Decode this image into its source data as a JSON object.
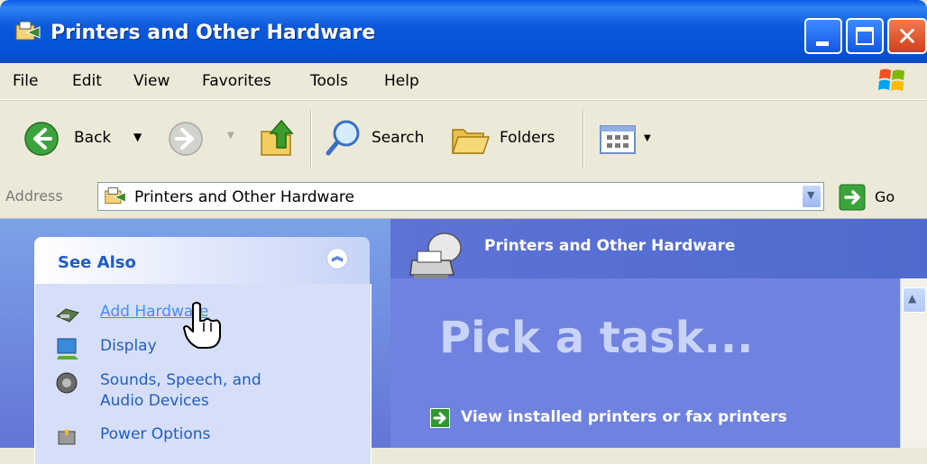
{
  "window": {
    "title": "Printers and Other Hardware"
  },
  "menu": {
    "items": [
      "File",
      "Edit",
      "View",
      "Favorites",
      "Tools",
      "Help"
    ]
  },
  "toolbar": {
    "back_label": "Back",
    "search_label": "Search",
    "folders_label": "Folders"
  },
  "address": {
    "label": "Address",
    "value": "Printers and Other Hardware",
    "go_label": "Go"
  },
  "see_also": {
    "title": "See Also",
    "items": [
      {
        "label": "Add Hardware",
        "icon": "add-hardware-icon"
      },
      {
        "label": "Display",
        "icon": "display-icon"
      },
      {
        "label": "Sounds, Speech, and",
        "label2": "Audio Devices",
        "icon": "speaker-icon"
      },
      {
        "label": "Power Options",
        "icon": "power-options-icon"
      }
    ]
  },
  "main": {
    "header_title": "Printers and Other Hardware",
    "pick_task": "Pick a task...",
    "tasks": [
      {
        "label": "View installed printers or fax printers"
      }
    ]
  },
  "colors": {
    "titlebar_blue": "#0452D6",
    "link_blue": "#215DC6",
    "pane_blue": "#6375D6"
  }
}
